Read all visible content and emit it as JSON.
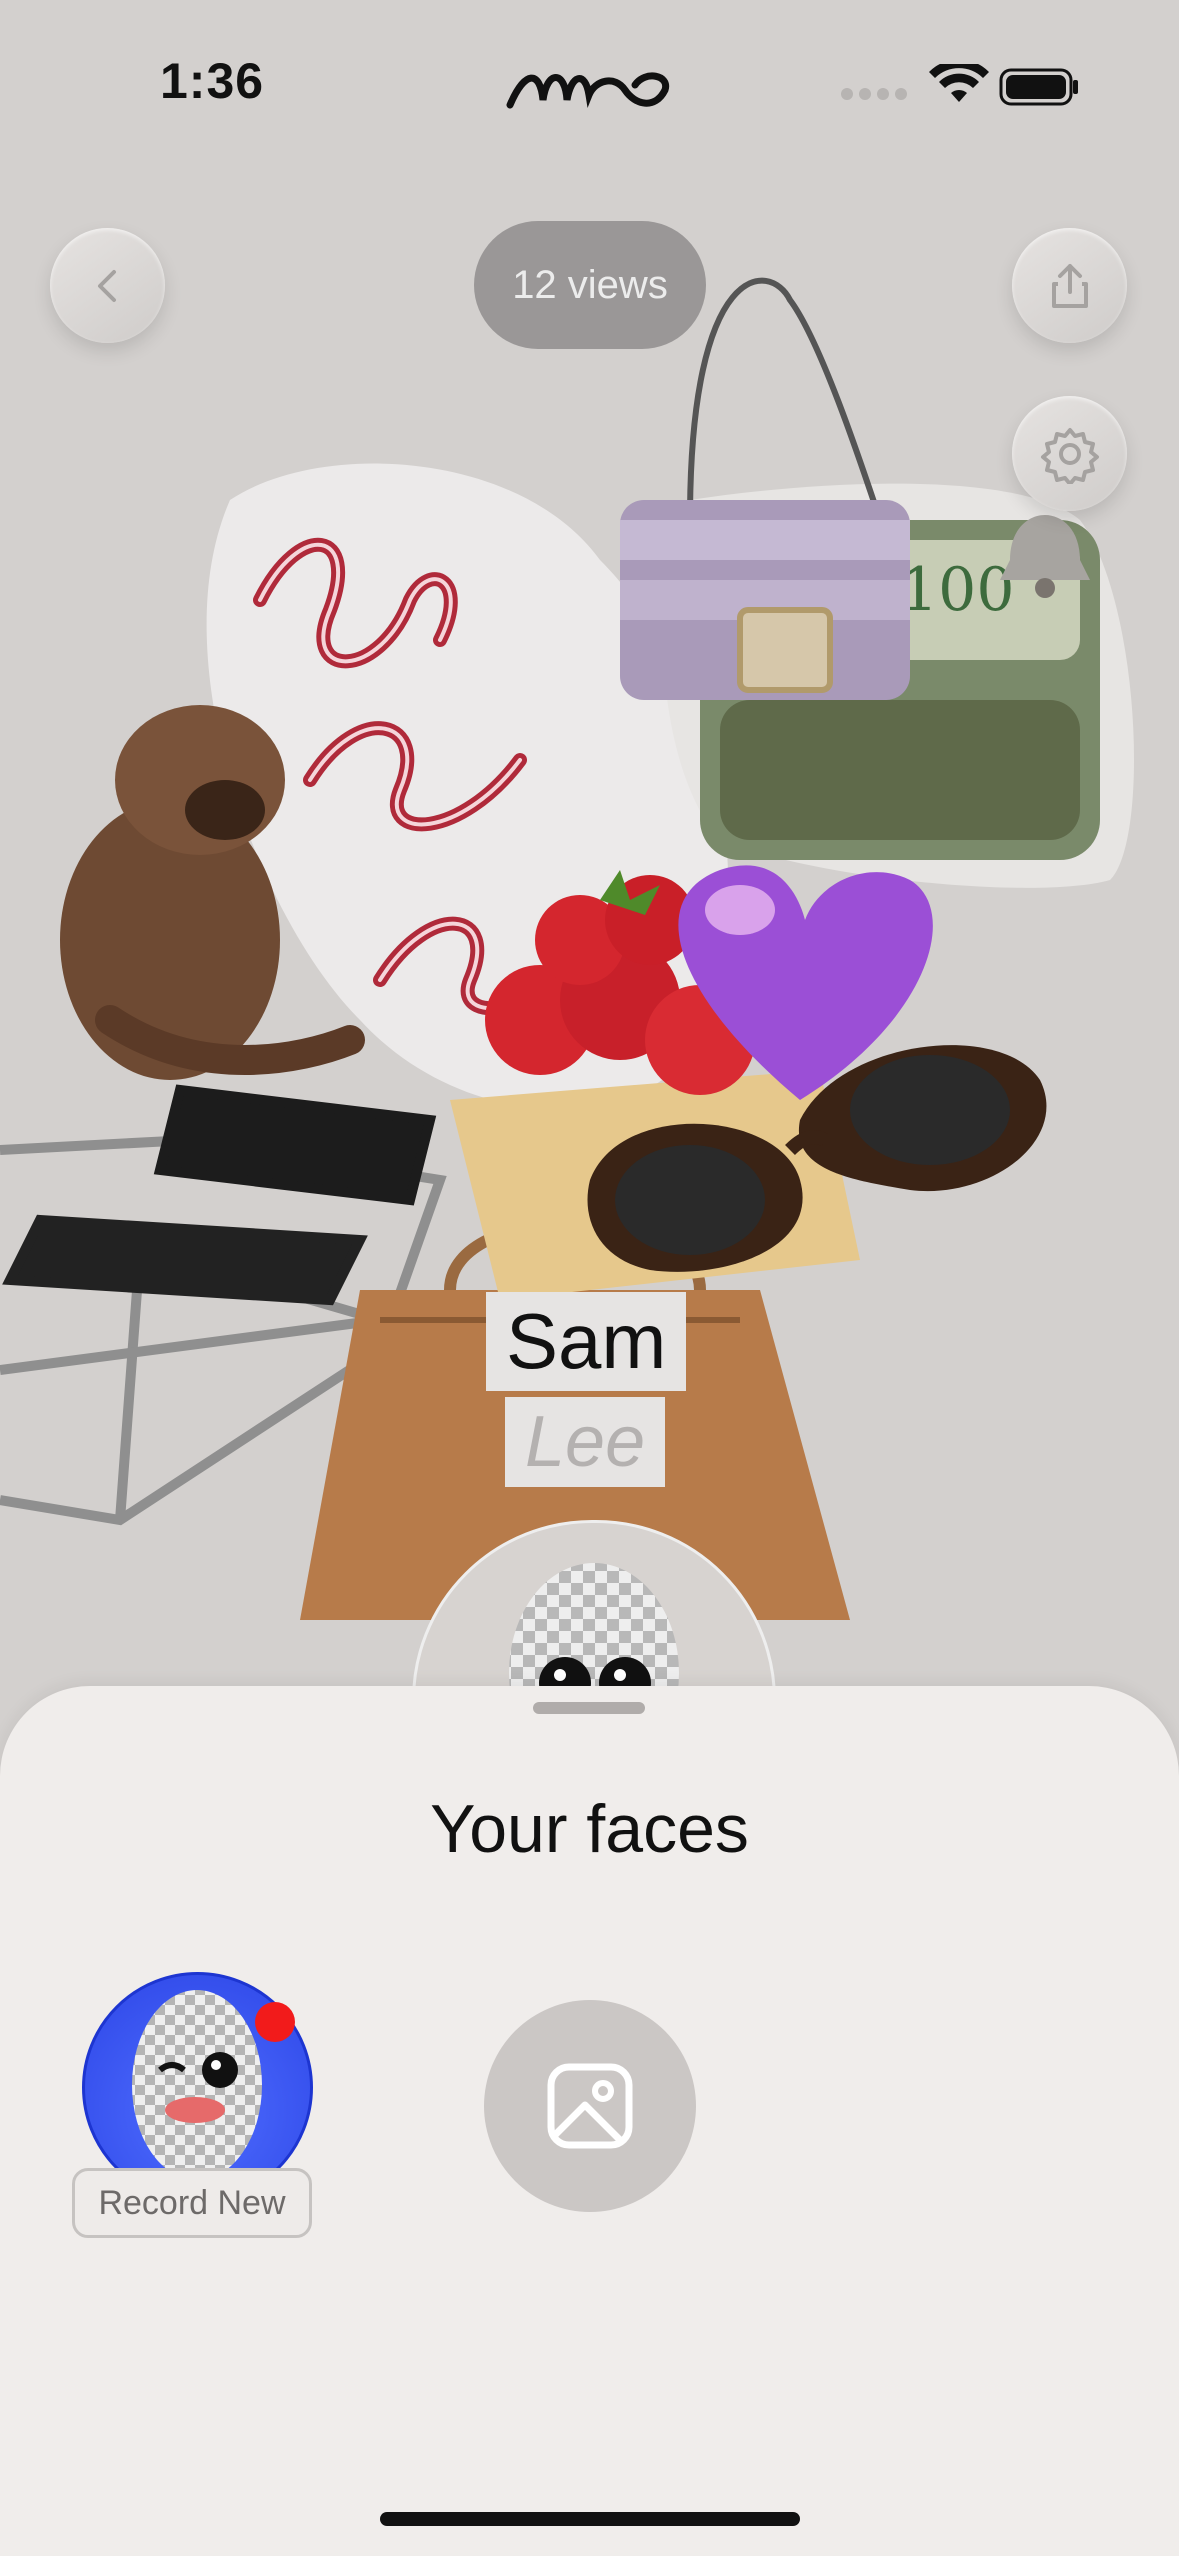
{
  "status": {
    "time": "1:36",
    "logo": "omo"
  },
  "header": {
    "views_label": "12 views"
  },
  "icons": {
    "back": "chevron-left-icon",
    "share": "share-icon",
    "settings": "gear-icon",
    "gallery": "image-icon"
  },
  "profile": {
    "first_name": "Sam",
    "last_name": "Lee"
  },
  "collage_items": [
    "bulldog sticker",
    "but first coffee neon sign",
    "handbag",
    "money roll",
    "heart",
    "strawberries",
    "sunglasses",
    "chair",
    "brown bag",
    "bell"
  ],
  "sheet": {
    "title": "Your faces",
    "record_new_label": "Record New"
  },
  "colors": {
    "background": "#d3d0ce",
    "sheet": "#f0edeb",
    "face_bg": "#2c45e6",
    "badge": "#f21b1b"
  }
}
